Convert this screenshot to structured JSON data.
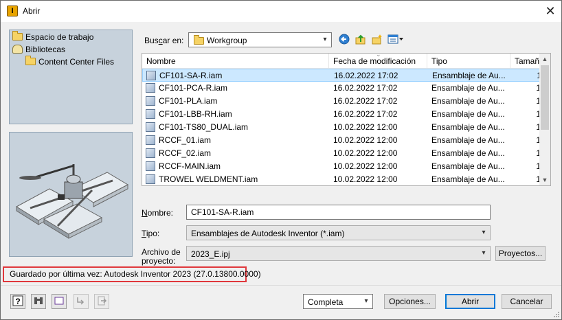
{
  "window": {
    "title": "Abrir",
    "app_icon": "inventor-app-icon",
    "close_glyph": "✕"
  },
  "places": [
    {
      "label": "Espacio de trabajo",
      "icon": "folder-icon"
    },
    {
      "label": "Bibliotecas",
      "icon": "library-icon"
    },
    {
      "label": "Content Center Files",
      "icon": "folder-icon"
    }
  ],
  "lookin": {
    "label_pre": "Bus",
    "label_underline": "c",
    "label_post": "ar en:",
    "value": "Workgroup",
    "tools": [
      "back-icon",
      "up-folder-icon",
      "new-folder-icon",
      "view-menu-icon"
    ]
  },
  "columns": [
    "Nombre",
    "Fecha de modificación",
    "Tipo",
    "Tamaño"
  ],
  "files": [
    {
      "name": "CF101-SA-R.iam",
      "date": "16.02.2022 17:02",
      "type": "Ensamblaje de Au...",
      "size": "1",
      "selected": true
    },
    {
      "name": "CF101-PCA-R.iam",
      "date": "16.02.2022 17:02",
      "type": "Ensamblaje de Au...",
      "size": "1"
    },
    {
      "name": "CF101-PLA.iam",
      "date": "16.02.2022 17:02",
      "type": "Ensamblaje de Au...",
      "size": "1"
    },
    {
      "name": "CF101-LBB-RH.iam",
      "date": "16.02.2022 17:02",
      "type": "Ensamblaje de Au...",
      "size": "1"
    },
    {
      "name": "CF101-TS80_DUAL.iam",
      "date": "10.02.2022 12:00",
      "type": "Ensamblaje de Au...",
      "size": "1"
    },
    {
      "name": "RCCF_01.iam",
      "date": "10.02.2022 12:00",
      "type": "Ensamblaje de Au...",
      "size": "1"
    },
    {
      "name": "RCCF_02.iam",
      "date": "10.02.2022 12:00",
      "type": "Ensamblaje de Au...",
      "size": "1"
    },
    {
      "name": "RCCF-MAIN.iam",
      "date": "10.02.2022 12:00",
      "type": "Ensamblaje de Au...",
      "size": "1"
    },
    {
      "name": "TROWEL WELDMENT.iam",
      "date": "10.02.2022 12:00",
      "type": "Ensamblaje de Au...",
      "size": "1"
    }
  ],
  "filename": {
    "label_pre": "",
    "label_underline": "N",
    "label_post": "ombre:",
    "value": "CF101-SA-R.iam"
  },
  "filetype": {
    "label_pre": "",
    "label_underline": "T",
    "label_post": "ipo:",
    "value": "Ensamblajes de Autodesk Inventor (*.iam)"
  },
  "project": {
    "label_line1": "Archivo de",
    "label_line2": "proyecto:",
    "value": "2023_E.ipj",
    "button": "Proyectos..."
  },
  "saved_info": "Guardado por última vez: Autodesk Inventor 2023 (27.0.13800.0000)",
  "footer": {
    "tool_buttons": [
      "help-icon",
      "find-icon",
      "preview-icon",
      "options-arrow-icon",
      "import-icon"
    ],
    "mode": "Completa",
    "options_button": "Opciones...",
    "open_button": "Abrir",
    "cancel_button": "Cancelar"
  },
  "colors": {
    "accent": "#0078d7",
    "selection": "#cce8ff",
    "highlight_box": "#e0373b",
    "panel": "#c7d2dc"
  }
}
